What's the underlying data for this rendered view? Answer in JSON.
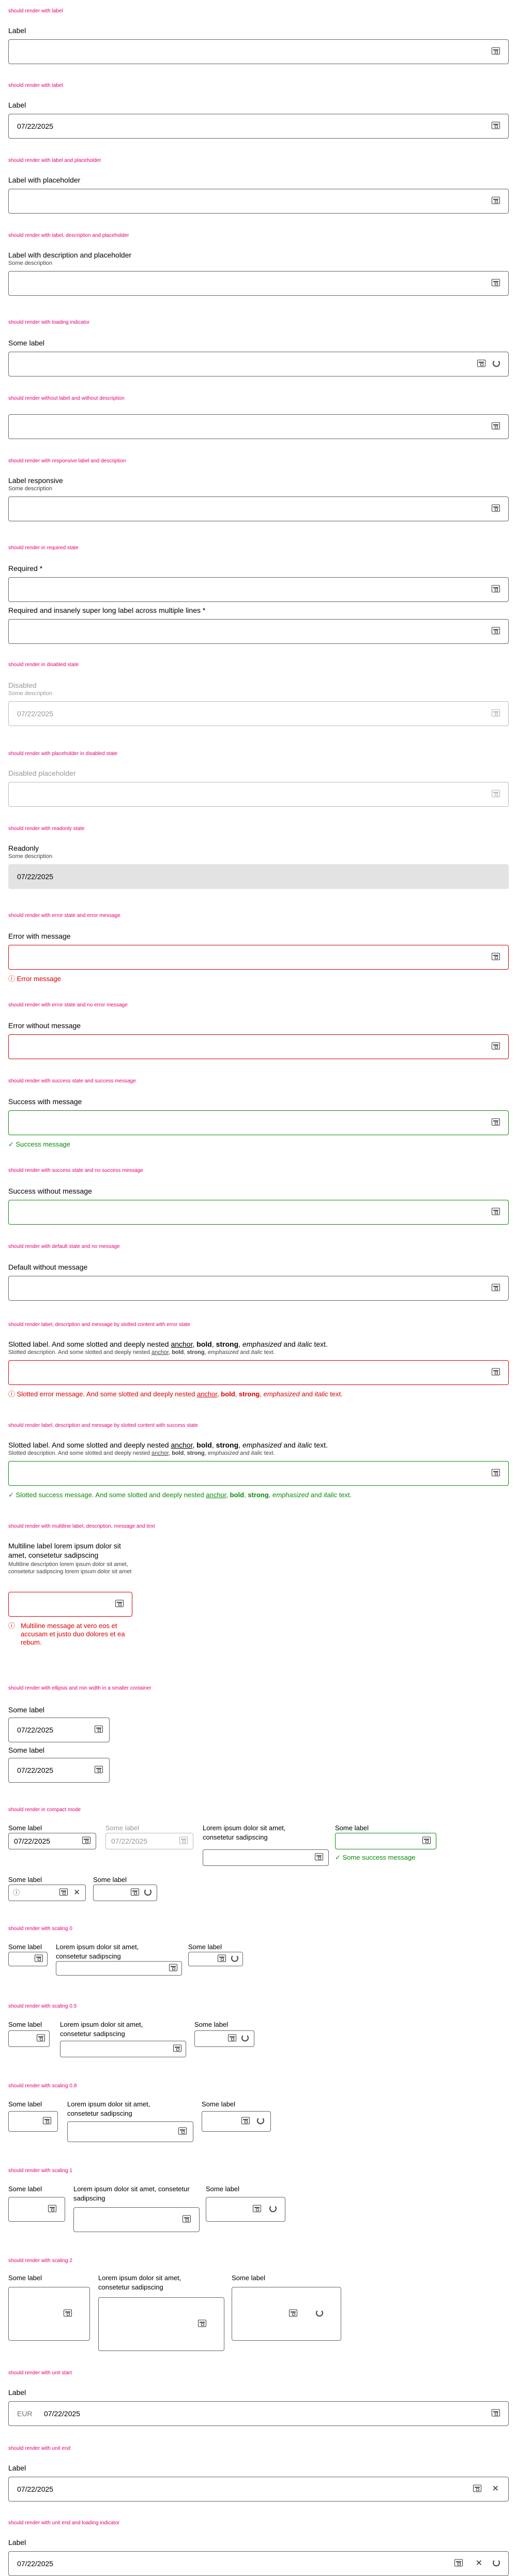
{
  "captions": {
    "c1": "should render with label",
    "c2": "should render with label",
    "c3": "should render with label and placeholder",
    "c4": "should render with label, description and placeholder",
    "c5": "should render with loading indicator",
    "c6": "should render without label and without description",
    "c7": "should render with responsive label and description",
    "c8": "should render in required state",
    "c9": "should render in disabled state",
    "c10": "should render with placeholder in disabled state",
    "c11": "should render with readonly state",
    "c12": "should render with error state and error message",
    "c13": "should render with error state and no error message",
    "c14": "should render with success state and success message",
    "c15": "should render with success state and no success message",
    "c16": "should render with default state and no message",
    "c17": "should render label, description and message by slotted content with error state",
    "c18": "should render label, description and message by slotted content with success state",
    "c19": "should render with multiline label, description, message and text",
    "c20": "should render with ellipsis and min width in a smaller container",
    "c21": "should render in compact mode",
    "c22": "should render with scaling 0",
    "c23": "should render with scaling 0.5",
    "c24": "should render with scaling 0.8",
    "c25": "should render with scaling 1",
    "c26": "should render with scaling 2",
    "c27": "should render with unit start",
    "c28": "should render with unit end",
    "c29": "should render with unit end and loading indicator"
  },
  "labels": {
    "label": "Label",
    "with_placeholder": "Label with placeholder",
    "with_desc_placeholder": "Label with description and placeholder",
    "some_label": "Some label",
    "responsive": "Label responsive",
    "required": "Required *",
    "required_long": "Required and insanely super long label across multiple lines *",
    "disabled": "Disabled",
    "disabled_placeholder": "Disabled placeholder",
    "readonly": "Readonly",
    "error_with": "Error with message",
    "error_without": "Error without message",
    "success_with": "Success with message",
    "success_without": "Success without message",
    "default_without": "Default without message",
    "lorem": "Lorem ipsum dolor sit amet, consetetur sadipscing",
    "multiline": "Multiline label lorem ipsum dolor sit amet, consetetur sadipscing"
  },
  "descriptions": {
    "some": "Some description",
    "multiline": "Multiline description lorem ipsum dolor sit amet, consetetur sadipscing lorem ipsum dolor sit amet",
    "slotted": "Slotted description. And some slotted and deeply nested"
  },
  "values": {
    "date": "07/22/2025",
    "unit_start": "EUR"
  },
  "messages": {
    "error": "Error message",
    "success": "Success message",
    "some_success": "Some success message",
    "multiline_error": "Multiline message at vero eos et accusam et justo duo dolores et ea rebum.",
    "slotted_error": "Slotted error message. And some slotted and deeply nested",
    "slotted_success": "Slotted success message. And some slotted and deeply nested"
  },
  "slotted": {
    "label": "Slotted label. And some slotted and deeply nested",
    "anchor": "anchor",
    "bold": "bold",
    "strong": "strong",
    "emph": "emphasized",
    "and": "and",
    "italic": "italic",
    "text": "text."
  },
  "icons": {
    "calendar": "calendar-icon",
    "spinner": "spinner-icon",
    "clear": "close-icon",
    "error": "error-icon",
    "success": "check-icon",
    "info": "info-icon"
  },
  "colors": {
    "caption": "#e20074",
    "error": "#d90000",
    "success": "#0a8a0a",
    "readonly_bg": "#e3e3e3"
  }
}
